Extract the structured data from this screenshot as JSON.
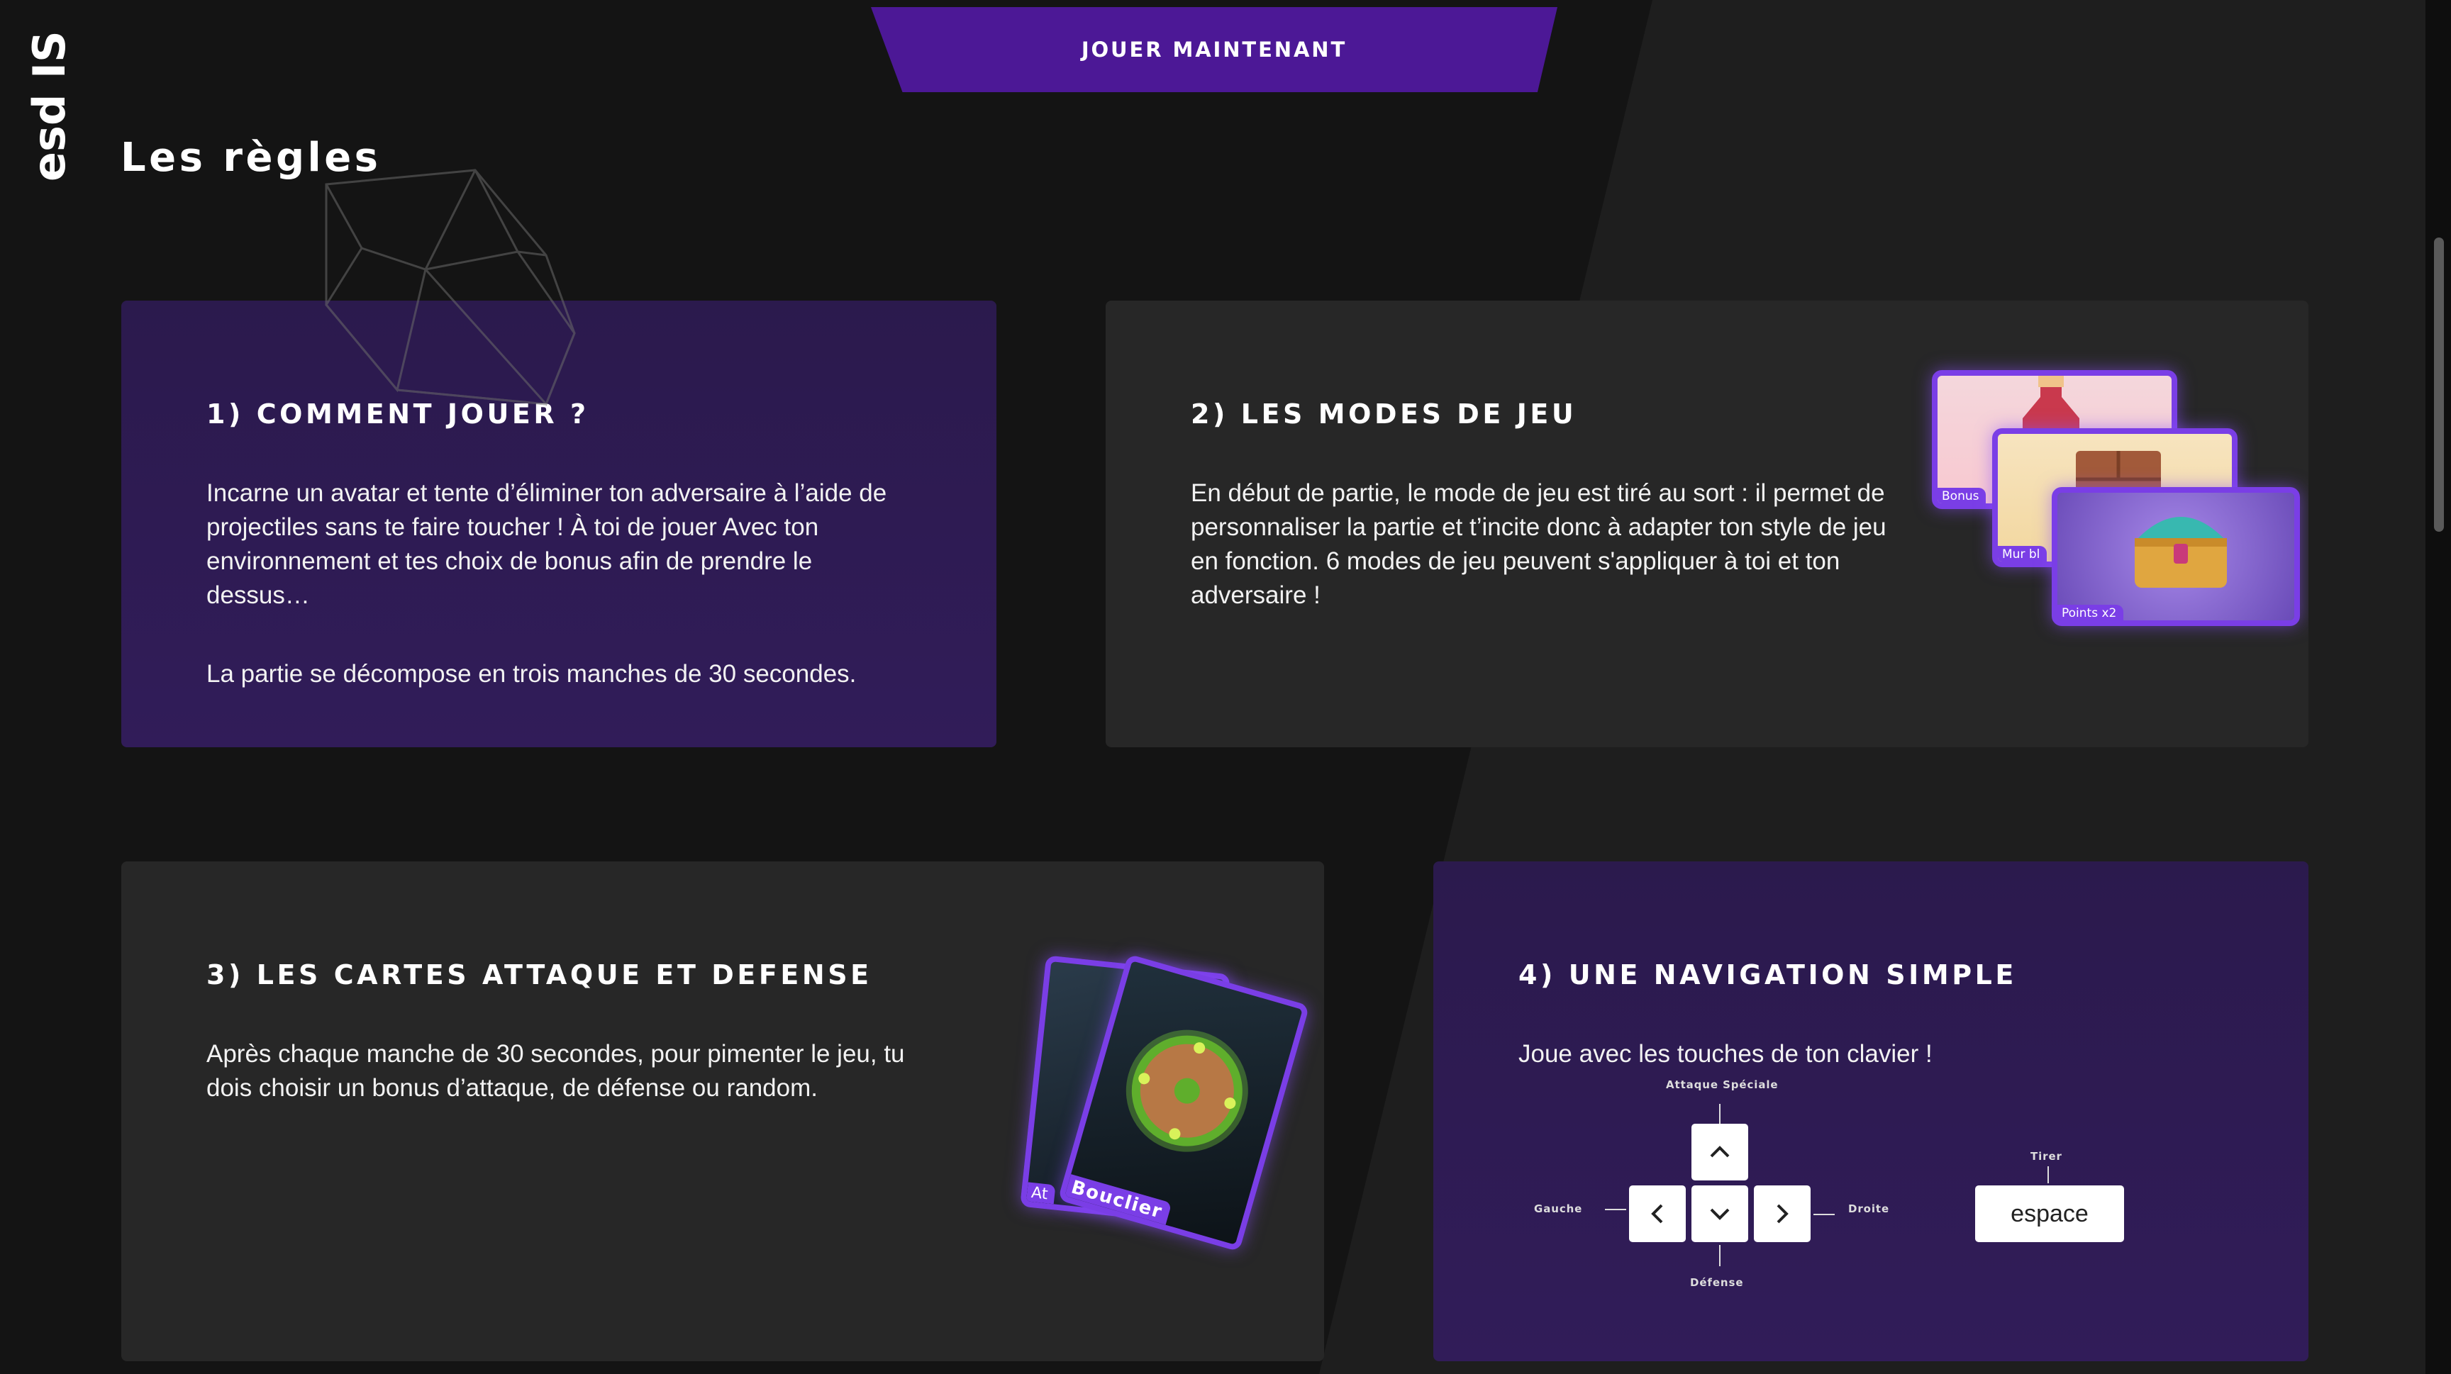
{
  "logo": {
    "text": "esd IS"
  },
  "hero": {
    "play_button": "JOUER MAINTENANT"
  },
  "section": {
    "title": "Les règles"
  },
  "cards": [
    {
      "title": "1) COMMENT JOUER ?",
      "paragraphs": [
        "Incarne un avatar et tente d’éliminer ton adversaire à l’aide de projectiles sans te faire toucher ! À toi de jouer Avec ton environnement et tes choix de bonus afin de prendre le dessus…",
        "La partie se décompose en trois manches de 30 secondes."
      ]
    },
    {
      "title": "2) LES MODES DE JEU",
      "paragraphs": [
        "En début de partie, le mode de jeu est tiré au sort : il permet de personnaliser la partie et t’incite donc à adapter ton style de jeu en fonction. 6 modes de jeu peuvent s'appliquer à toi et ton adversaire !"
      ],
      "mode_cards": [
        "Bonus",
        "Mur bl",
        "Points x2"
      ]
    },
    {
      "title": "3) LES CARTES ATTAQUE ET DEFENSE",
      "paragraphs": [
        "Après chaque manche de 30 secondes, pour pimenter le jeu, tu dois choisir un bonus d’attaque, de défense ou random."
      ],
      "card_labels": [
        "At",
        "Bouclier"
      ]
    },
    {
      "title": "4) UNE NAVIGATION SIMPLE",
      "paragraphs": [
        "Joue avec les touches de ton clavier !"
      ],
      "controls": {
        "up": "Attaque Spéciale",
        "left": "Gauche",
        "right": "Droite",
        "down": "Défense",
        "shoot": "Tirer",
        "space_key": "espace"
      }
    }
  ],
  "colors": {
    "accent": "#4c1896",
    "card_purple": "#2b1a4d",
    "card_grey": "#272727",
    "background": "#141414",
    "glow": "#7a3ee6"
  }
}
